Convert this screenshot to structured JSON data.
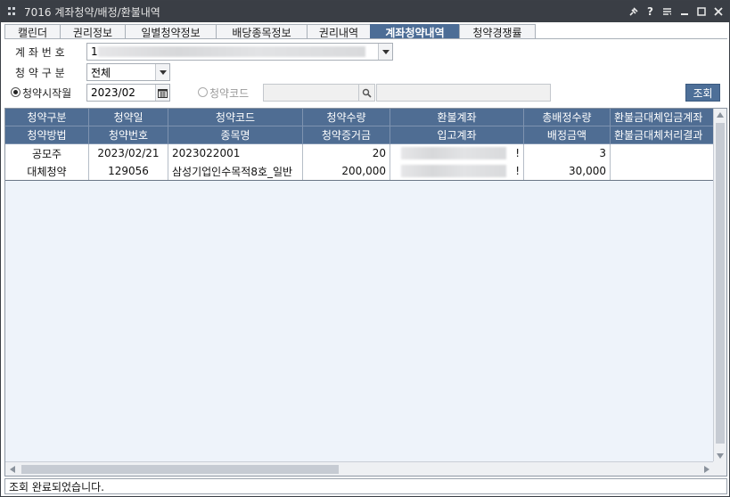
{
  "window": {
    "title": "7016 계좌청약/배정/환불내역",
    "buttons": [
      "pin",
      "help",
      "menu",
      "minimize",
      "maximize",
      "close"
    ]
  },
  "tabs": [
    {
      "label": "캘린더",
      "active": false
    },
    {
      "label": "권리정보",
      "active": false
    },
    {
      "label": "일별청약정보",
      "active": false
    },
    {
      "label": "배당종목정보",
      "active": false
    },
    {
      "label": "권리내역",
      "active": false
    },
    {
      "label": "계좌청약내역",
      "active": true
    },
    {
      "label": "청약경쟁률",
      "active": false
    }
  ],
  "form": {
    "account_label": "계 좌 번 호",
    "account_value": "1",
    "subscription_type_label": "청 약 구 분",
    "subscription_type_value": "전체",
    "start_month_radio_label": "청약시작월",
    "start_month_value": "2023/02",
    "code_radio_label": "청약코드",
    "query_button": "조회"
  },
  "grid": {
    "header_row1": [
      "청약구분",
      "청약일",
      "청약코드",
      "청약수량",
      "환불계좌",
      "총배정수량",
      "환불금대체입금계좌"
    ],
    "header_row2": [
      "청약방법",
      "청약번호",
      "종목명",
      "청약증거금",
      "입고계좌",
      "배정금액",
      "환불금대체처리결과"
    ],
    "rows": [
      {
        "line1": [
          "공모주",
          "2023/02/21",
          "2023022001",
          "20",
          "!",
          "3",
          ""
        ],
        "line2": [
          "대체청약",
          "129056",
          "삼성기업인수목적8호_일반",
          "200,000",
          "!",
          "30,000",
          ""
        ]
      }
    ]
  },
  "status": {
    "message": "조회 완료되었습니다."
  },
  "colors": {
    "titlebar": "#3a3e45",
    "header": "#4f6d93",
    "active_tab": "#4c6d96",
    "grid_bg": "#eef3fa"
  }
}
